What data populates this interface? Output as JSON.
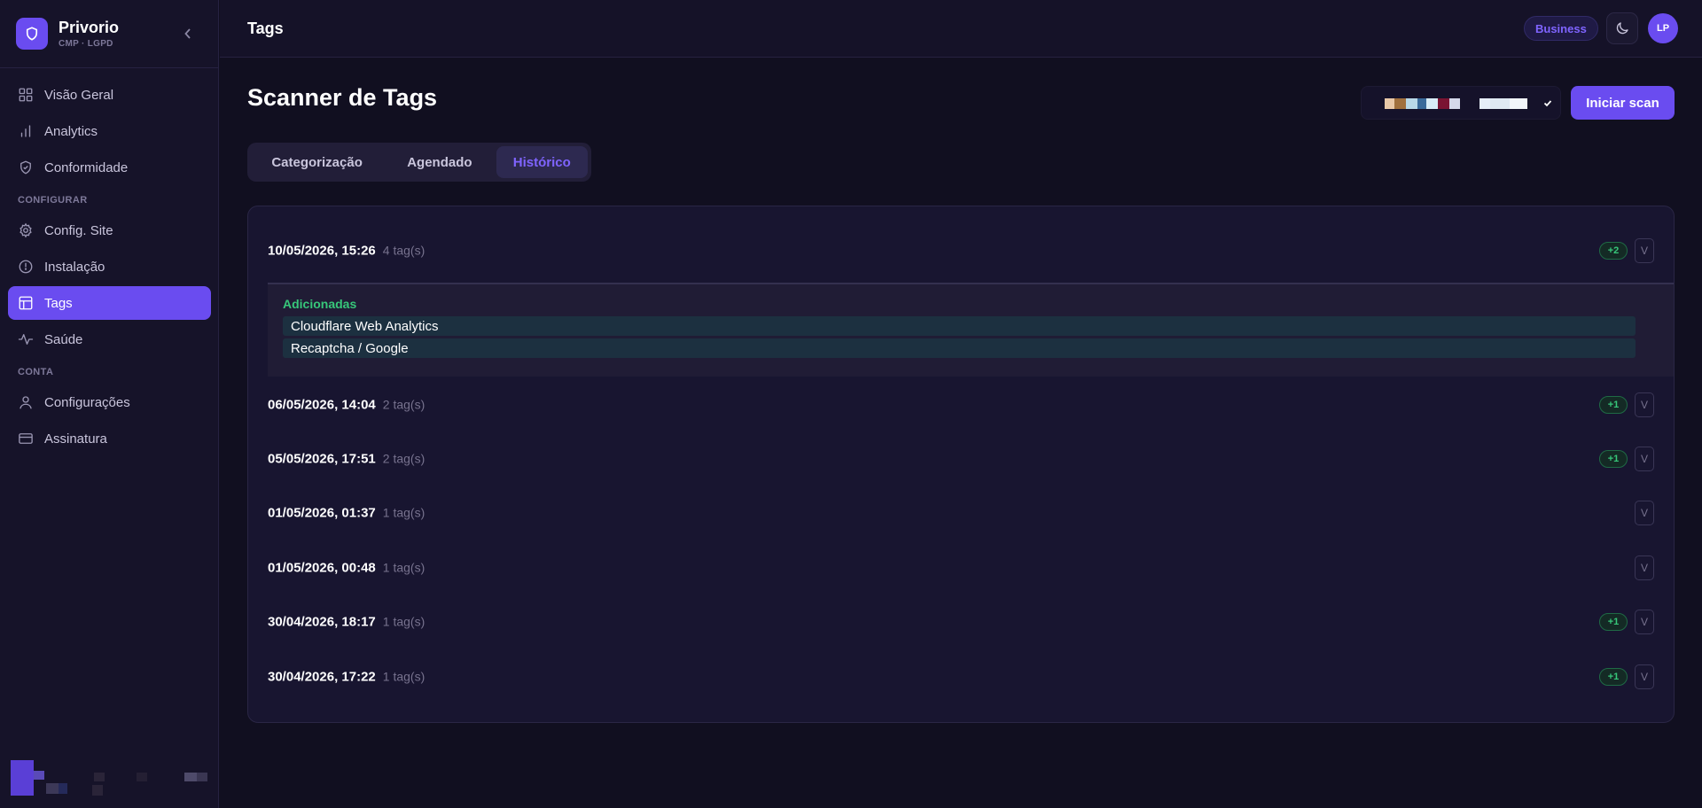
{
  "brand": {
    "name": "Privorio",
    "subtitle": "CMP · LGPD"
  },
  "sidebar": {
    "items_top": [
      {
        "label": "Visão Geral",
        "icon": "grid-icon"
      },
      {
        "label": "Analytics",
        "icon": "bar-chart-icon"
      },
      {
        "label": "Conformidade",
        "icon": "shield-check-icon"
      }
    ],
    "section_configurar": "CONFIGURAR",
    "items_configurar": [
      {
        "label": "Config. Site",
        "icon": "gear-icon"
      },
      {
        "label": "Instalação",
        "icon": "install-icon"
      },
      {
        "label": "Tags",
        "icon": "table-icon",
        "active": true
      },
      {
        "label": "Saúde",
        "icon": "pulse-icon"
      }
    ],
    "section_conta": "CONTA",
    "items_conta": [
      {
        "label": "Configurações",
        "icon": "user-icon"
      },
      {
        "label": "Assinatura",
        "icon": "credit-card-icon"
      }
    ]
  },
  "topbar": {
    "title": "Tags",
    "plan": "Business",
    "avatar_initials": "LP"
  },
  "page": {
    "title": "Scanner de Tags",
    "scan_button": "Iniciar scan",
    "tabs": [
      "Categorização",
      "Agendado",
      "Histórico"
    ],
    "active_tab": "Histórico"
  },
  "history": [
    {
      "date": "10/05/2026, 15:26",
      "count": "4 tag(s)",
      "delta": "+2",
      "toggle": "V",
      "expanded": true
    },
    {
      "date": "06/05/2026, 14:04",
      "count": "2 tag(s)",
      "delta": "+1",
      "toggle": "V"
    },
    {
      "date": "05/05/2026, 17:51",
      "count": "2 tag(s)",
      "delta": "+1",
      "toggle": "V"
    },
    {
      "date": "01/05/2026, 01:37",
      "count": "1 tag(s)",
      "delta": "",
      "toggle": "V"
    },
    {
      "date": "01/05/2026, 00:48",
      "count": "1 tag(s)",
      "delta": "",
      "toggle": "V"
    },
    {
      "date": "30/04/2026, 18:17",
      "count": "1 tag(s)",
      "delta": "+1",
      "toggle": "V"
    },
    {
      "date": "30/04/2026, 17:22",
      "count": "1 tag(s)",
      "delta": "+1",
      "toggle": "V"
    }
  ],
  "expanded_detail": {
    "label": "Adicionadas",
    "tags": [
      "Cloudflare Web Analytics",
      "Recaptcha / Google"
    ]
  },
  "colors": {
    "accent": "#6a4cf0",
    "accent_text": "#7f64ff",
    "success": "#37c77a",
    "background": "#110f20",
    "sidebar": "#161329",
    "card": "#181530"
  }
}
